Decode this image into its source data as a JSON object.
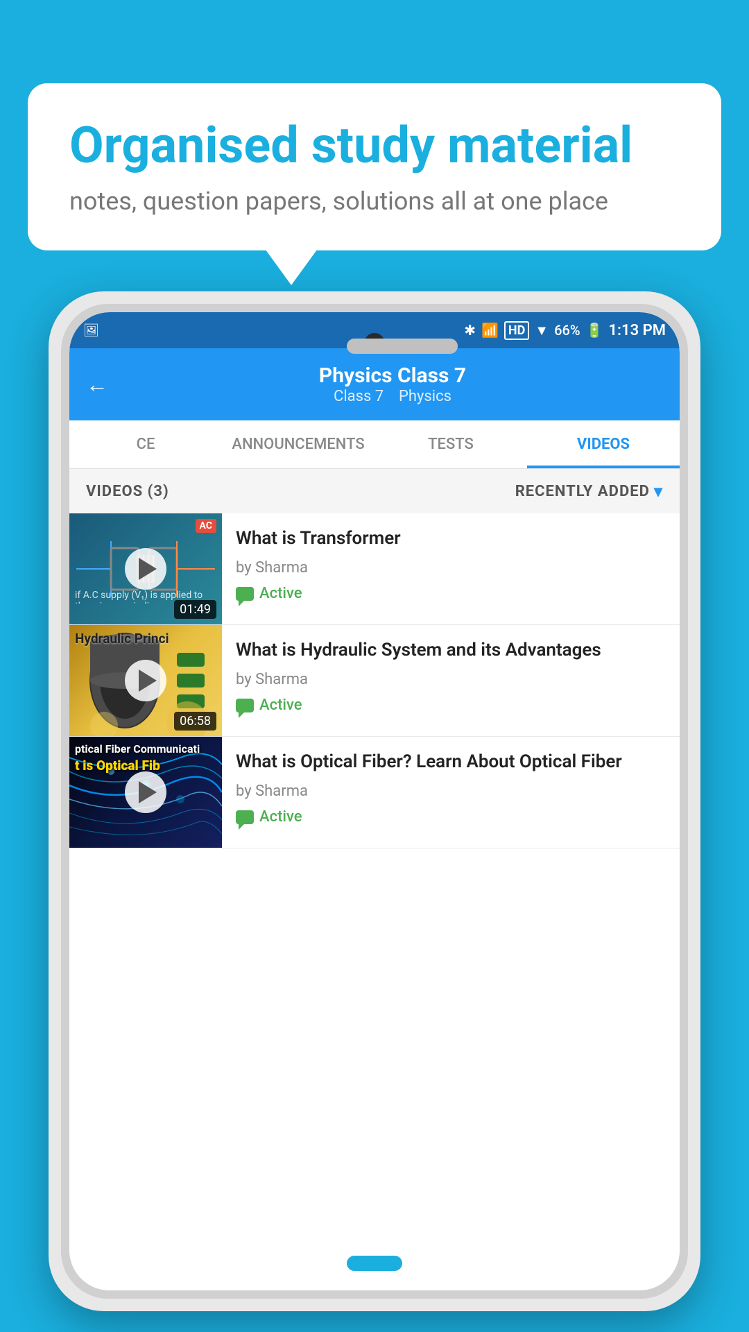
{
  "background_color": "#1aafde",
  "speech_bubble": {
    "title": "Organised study material",
    "subtitle": "notes, question papers, solutions all at one place"
  },
  "status_bar": {
    "time": "1:13 PM",
    "battery": "66%",
    "signal": "HD"
  },
  "header": {
    "title": "Physics Class 7",
    "subtitle_class": "Class 7",
    "subtitle_subject": "Physics",
    "back_label": "←"
  },
  "tabs": [
    {
      "label": "CE",
      "active": false
    },
    {
      "label": "ANNOUNCEMENTS",
      "active": false
    },
    {
      "label": "TESTS",
      "active": false
    },
    {
      "label": "VIDEOS",
      "active": true
    }
  ],
  "videos_bar": {
    "count_label": "VIDEOS (3)",
    "sort_label": "RECENTLY ADDED"
  },
  "videos": [
    {
      "title": "What is  Transformer",
      "author": "by Sharma",
      "status": "Active",
      "duration": "01:49",
      "thumb_type": "transformer"
    },
    {
      "title": "What is Hydraulic System and its Advantages",
      "author": "by Sharma",
      "status": "Active",
      "duration": "06:58",
      "thumb_type": "hydraulic",
      "thumb_text": "Hydraulic Princi"
    },
    {
      "title": "What is Optical Fiber? Learn About Optical Fiber",
      "author": "by Sharma",
      "status": "Active",
      "duration": "",
      "thumb_type": "optical",
      "thumb_text": "ptical Fiber Communicati",
      "thumb_text2": "t is Optical Fib"
    }
  ]
}
